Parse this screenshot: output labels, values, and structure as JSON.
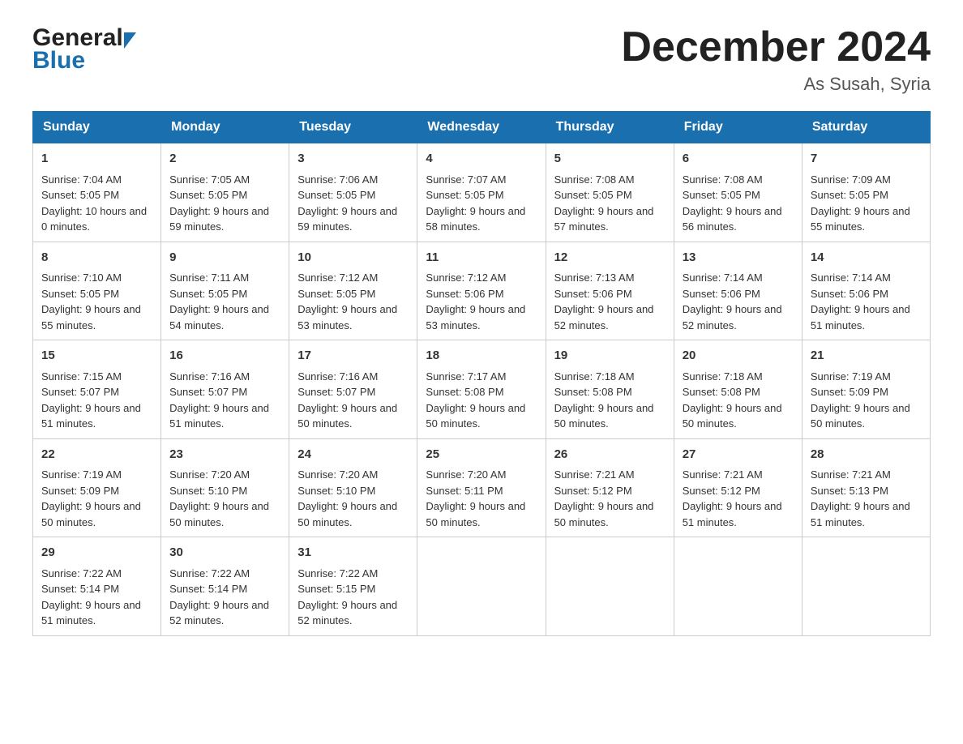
{
  "logo": {
    "general": "General",
    "blue": "Blue"
  },
  "title": "December 2024",
  "subtitle": "As Susah, Syria",
  "days": [
    "Sunday",
    "Monday",
    "Tuesday",
    "Wednesday",
    "Thursday",
    "Friday",
    "Saturday"
  ],
  "weeks": [
    [
      {
        "day": "1",
        "sunrise": "7:04 AM",
        "sunset": "5:05 PM",
        "daylight": "10 hours and 0 minutes."
      },
      {
        "day": "2",
        "sunrise": "7:05 AM",
        "sunset": "5:05 PM",
        "daylight": "9 hours and 59 minutes."
      },
      {
        "day": "3",
        "sunrise": "7:06 AM",
        "sunset": "5:05 PM",
        "daylight": "9 hours and 59 minutes."
      },
      {
        "day": "4",
        "sunrise": "7:07 AM",
        "sunset": "5:05 PM",
        "daylight": "9 hours and 58 minutes."
      },
      {
        "day": "5",
        "sunrise": "7:08 AM",
        "sunset": "5:05 PM",
        "daylight": "9 hours and 57 minutes."
      },
      {
        "day": "6",
        "sunrise": "7:08 AM",
        "sunset": "5:05 PM",
        "daylight": "9 hours and 56 minutes."
      },
      {
        "day": "7",
        "sunrise": "7:09 AM",
        "sunset": "5:05 PM",
        "daylight": "9 hours and 55 minutes."
      }
    ],
    [
      {
        "day": "8",
        "sunrise": "7:10 AM",
        "sunset": "5:05 PM",
        "daylight": "9 hours and 55 minutes."
      },
      {
        "day": "9",
        "sunrise": "7:11 AM",
        "sunset": "5:05 PM",
        "daylight": "9 hours and 54 minutes."
      },
      {
        "day": "10",
        "sunrise": "7:12 AM",
        "sunset": "5:05 PM",
        "daylight": "9 hours and 53 minutes."
      },
      {
        "day": "11",
        "sunrise": "7:12 AM",
        "sunset": "5:06 PM",
        "daylight": "9 hours and 53 minutes."
      },
      {
        "day": "12",
        "sunrise": "7:13 AM",
        "sunset": "5:06 PM",
        "daylight": "9 hours and 52 minutes."
      },
      {
        "day": "13",
        "sunrise": "7:14 AM",
        "sunset": "5:06 PM",
        "daylight": "9 hours and 52 minutes."
      },
      {
        "day": "14",
        "sunrise": "7:14 AM",
        "sunset": "5:06 PM",
        "daylight": "9 hours and 51 minutes."
      }
    ],
    [
      {
        "day": "15",
        "sunrise": "7:15 AM",
        "sunset": "5:07 PM",
        "daylight": "9 hours and 51 minutes."
      },
      {
        "day": "16",
        "sunrise": "7:16 AM",
        "sunset": "5:07 PM",
        "daylight": "9 hours and 51 minutes."
      },
      {
        "day": "17",
        "sunrise": "7:16 AM",
        "sunset": "5:07 PM",
        "daylight": "9 hours and 50 minutes."
      },
      {
        "day": "18",
        "sunrise": "7:17 AM",
        "sunset": "5:08 PM",
        "daylight": "9 hours and 50 minutes."
      },
      {
        "day": "19",
        "sunrise": "7:18 AM",
        "sunset": "5:08 PM",
        "daylight": "9 hours and 50 minutes."
      },
      {
        "day": "20",
        "sunrise": "7:18 AM",
        "sunset": "5:08 PM",
        "daylight": "9 hours and 50 minutes."
      },
      {
        "day": "21",
        "sunrise": "7:19 AM",
        "sunset": "5:09 PM",
        "daylight": "9 hours and 50 minutes."
      }
    ],
    [
      {
        "day": "22",
        "sunrise": "7:19 AM",
        "sunset": "5:09 PM",
        "daylight": "9 hours and 50 minutes."
      },
      {
        "day": "23",
        "sunrise": "7:20 AM",
        "sunset": "5:10 PM",
        "daylight": "9 hours and 50 minutes."
      },
      {
        "day": "24",
        "sunrise": "7:20 AM",
        "sunset": "5:10 PM",
        "daylight": "9 hours and 50 minutes."
      },
      {
        "day": "25",
        "sunrise": "7:20 AM",
        "sunset": "5:11 PM",
        "daylight": "9 hours and 50 minutes."
      },
      {
        "day": "26",
        "sunrise": "7:21 AM",
        "sunset": "5:12 PM",
        "daylight": "9 hours and 50 minutes."
      },
      {
        "day": "27",
        "sunrise": "7:21 AM",
        "sunset": "5:12 PM",
        "daylight": "9 hours and 51 minutes."
      },
      {
        "day": "28",
        "sunrise": "7:21 AM",
        "sunset": "5:13 PM",
        "daylight": "9 hours and 51 minutes."
      }
    ],
    [
      {
        "day": "29",
        "sunrise": "7:22 AM",
        "sunset": "5:14 PM",
        "daylight": "9 hours and 51 minutes."
      },
      {
        "day": "30",
        "sunrise": "7:22 AM",
        "sunset": "5:14 PM",
        "daylight": "9 hours and 52 minutes."
      },
      {
        "day": "31",
        "sunrise": "7:22 AM",
        "sunset": "5:15 PM",
        "daylight": "9 hours and 52 minutes."
      },
      null,
      null,
      null,
      null
    ]
  ],
  "labels": {
    "sunrise": "Sunrise:",
    "sunset": "Sunset:",
    "daylight": "Daylight:"
  }
}
